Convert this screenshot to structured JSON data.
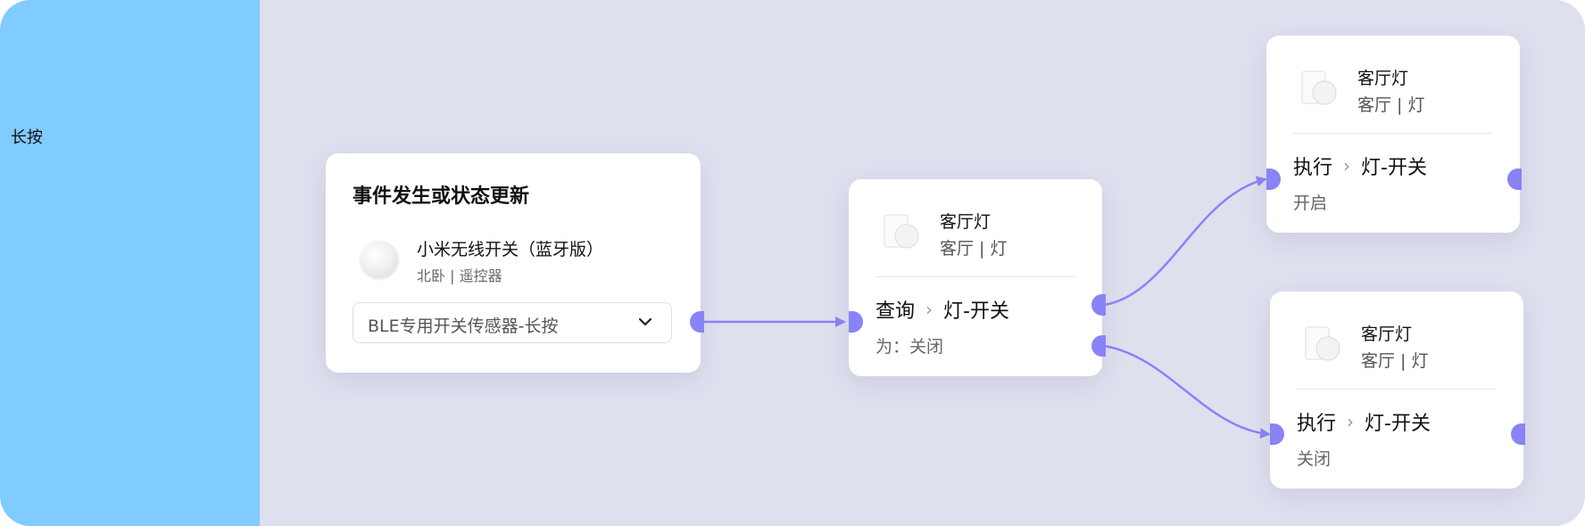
{
  "sidebar": {
    "label": "长按"
  },
  "trigger": {
    "title": "事件发生或状态更新",
    "device": {
      "name": "小米无线开关（蓝牙版）",
      "location": "北卧 | 遥控器"
    },
    "event_select": {
      "value": "BLE专用开关传感器-长按"
    }
  },
  "query_node": {
    "device": {
      "name": "客厅灯",
      "location": "客厅 | 灯"
    },
    "action": {
      "verb": "查询",
      "separator": "›",
      "capability": "灯-开关"
    },
    "condition": "为：关闭"
  },
  "action_on_node": {
    "device": {
      "name": "客厅灯",
      "location": "客厅 | 灯"
    },
    "action": {
      "verb": "执行",
      "separator": "›",
      "capability": "灯-开关"
    },
    "value": "开启"
  },
  "action_off_node": {
    "device": {
      "name": "客厅灯",
      "location": "客厅 | 灯"
    },
    "action": {
      "verb": "执行",
      "separator": "›",
      "capability": "灯-开关"
    },
    "value": "关闭"
  },
  "colors": {
    "sidebar": "#80cbff",
    "canvas": "#dee0ee",
    "wire": "#8a83f7"
  }
}
